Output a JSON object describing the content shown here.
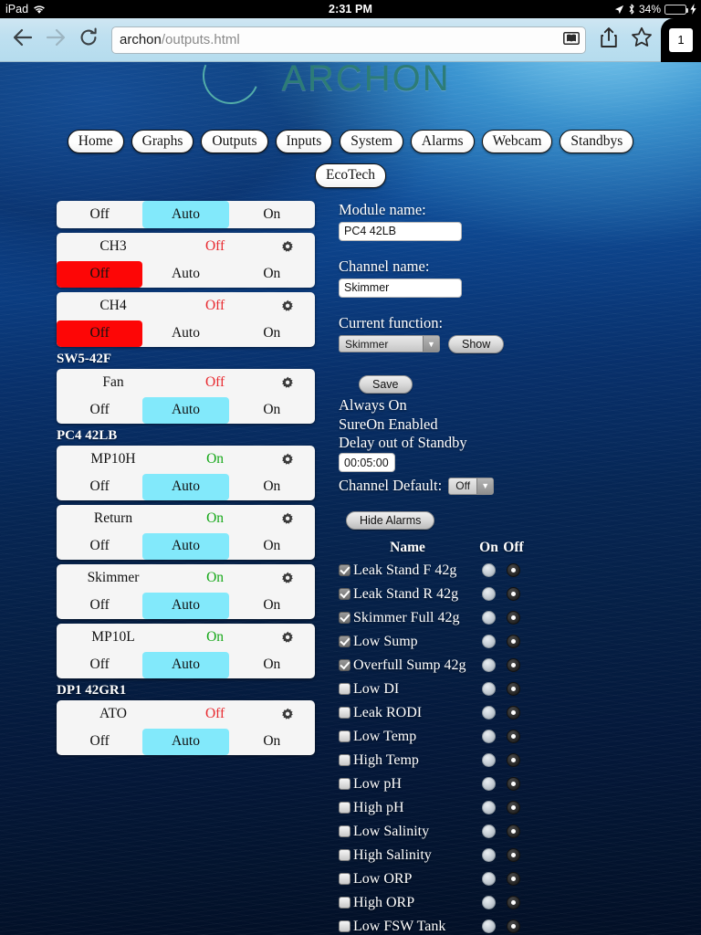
{
  "statusbar": {
    "device": "iPad",
    "wifi_icon": "wifi-icon",
    "time": "2:31 PM",
    "location_icon": "location-arrow-icon",
    "bluetooth_icon": "bluetooth-icon",
    "battery_percent": "34%",
    "battery_level": 34,
    "charging_icon": "lightning-bolt-icon",
    "battery_color": "#4cd964"
  },
  "toolbar": {
    "back_icon": "back-arrow-icon",
    "forward_icon": "forward-arrow-icon",
    "reload_icon": "reload-icon",
    "url_host": "archon",
    "url_path": "/outputs.html",
    "url_full": "archon/outputs.html",
    "reader_icon": "reader-view-icon",
    "share_icon": "share-icon",
    "bookmark_icon": "star-icon",
    "tab_count": "1"
  },
  "site": {
    "logo_text": "ARCHON",
    "logo_color": "#2d7c77"
  },
  "nav": {
    "primary": [
      {
        "label": "Home"
      },
      {
        "label": "Graphs"
      },
      {
        "label": "Outputs"
      },
      {
        "label": "Inputs"
      },
      {
        "label": "System"
      },
      {
        "label": "Alarms"
      },
      {
        "label": "Webcam"
      },
      {
        "label": "Standbys"
      }
    ],
    "secondary": [
      {
        "label": "EcoTech"
      }
    ]
  },
  "outputs": {
    "segment_labels": {
      "off": "Off",
      "auto": "Auto",
      "on": "On"
    },
    "gear_icon": "gear-icon",
    "blocks": [
      {
        "group": null,
        "channels": [
          {
            "name": "",
            "state": "",
            "state_color": "",
            "selected": "auto",
            "clipped": true,
            "show_top": false
          }
        ]
      },
      {
        "group": null,
        "channels": [
          {
            "name": "CH3",
            "state": "Off",
            "state_color": "#e8292f",
            "selected": "off",
            "clipped": false,
            "show_top": true
          },
          {
            "name": "CH4",
            "state": "Off",
            "state_color": "#e8292f",
            "selected": "off",
            "clipped": false,
            "show_top": true
          }
        ]
      },
      {
        "group": "SW5-42F",
        "channels": [
          {
            "name": "Fan",
            "state": "Off",
            "state_color": "#e8292f",
            "selected": "auto",
            "clipped": false,
            "show_top": true
          }
        ]
      },
      {
        "group": "PC4 42LB",
        "channels": [
          {
            "name": "MP10H",
            "state": "On",
            "state_color": "#17a81a",
            "selected": "auto",
            "clipped": false,
            "show_top": true
          },
          {
            "name": "Return",
            "state": "On",
            "state_color": "#17a81a",
            "selected": "auto",
            "clipped": false,
            "show_top": true
          },
          {
            "name": "Skimmer",
            "state": "On",
            "state_color": "#17a81a",
            "selected": "auto",
            "clipped": false,
            "show_top": true
          },
          {
            "name": "MP10L",
            "state": "On",
            "state_color": "#17a81a",
            "selected": "auto",
            "clipped": false,
            "show_top": true
          }
        ]
      },
      {
        "group": "DP1 42GR1",
        "channels": [
          {
            "name": "ATO",
            "state": "Off",
            "state_color": "#e8292f",
            "selected": "auto",
            "clipped": false,
            "show_top": true
          }
        ]
      }
    ]
  },
  "detail": {
    "module_name_label": "Module name:",
    "module_name_value": "PC4 42LB",
    "channel_name_label": "Channel name:",
    "channel_name_value": "Skimmer",
    "current_function_label": "Current function:",
    "current_function_value": "Skimmer",
    "show_button": "Show",
    "save_button": "Save",
    "status_lines": [
      "Always On",
      "SureOn Enabled",
      "Delay out of Standby"
    ],
    "delay_value": "00:05:00",
    "channel_default_label": "Channel Default:",
    "channel_default_value": "Off",
    "hide_alarms_button": "Hide Alarms"
  },
  "alarms": {
    "headers": {
      "name": "Name",
      "on": "On",
      "off": "Off"
    },
    "rows": [
      {
        "name": "Leak Stand F 42g",
        "enabled": true,
        "mode": "off"
      },
      {
        "name": "Leak Stand R 42g",
        "enabled": true,
        "mode": "off"
      },
      {
        "name": "Skimmer Full 42g",
        "enabled": true,
        "mode": "off"
      },
      {
        "name": "Low Sump",
        "enabled": true,
        "mode": "off"
      },
      {
        "name": "Overfull Sump 42g",
        "enabled": true,
        "mode": "off"
      },
      {
        "name": "Low DI",
        "enabled": false,
        "mode": "off"
      },
      {
        "name": "Leak RODI",
        "enabled": false,
        "mode": "off"
      },
      {
        "name": "Low Temp",
        "enabled": false,
        "mode": "off"
      },
      {
        "name": "High Temp",
        "enabled": false,
        "mode": "off"
      },
      {
        "name": "Low pH",
        "enabled": false,
        "mode": "off"
      },
      {
        "name": "High pH",
        "enabled": false,
        "mode": "off"
      },
      {
        "name": "Low Salinity",
        "enabled": false,
        "mode": "off"
      },
      {
        "name": "High Salinity",
        "enabled": false,
        "mode": "off"
      },
      {
        "name": "Low ORP",
        "enabled": false,
        "mode": "off"
      },
      {
        "name": "High ORP",
        "enabled": false,
        "mode": "off"
      },
      {
        "name": "Low FSW Tank",
        "enabled": false,
        "mode": "off"
      }
    ]
  }
}
